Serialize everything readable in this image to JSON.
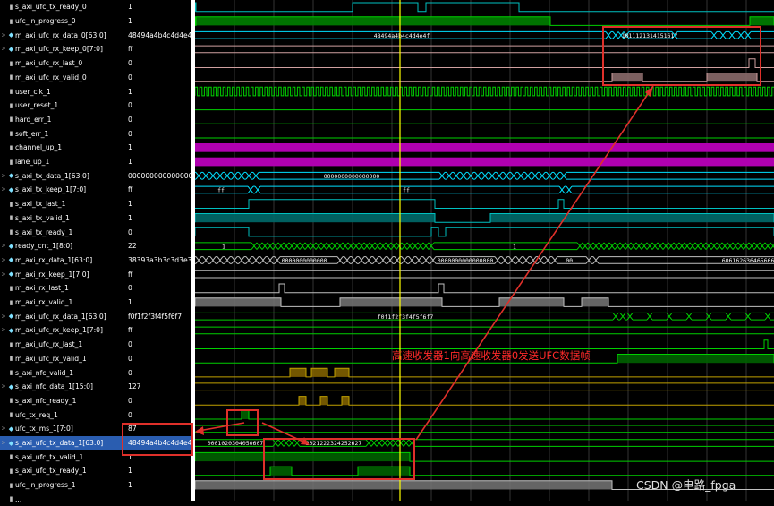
{
  "signals": [
    {
      "name": "s_axi_ufc_tx_ready_0",
      "value": "1",
      "group": false,
      "kind": "bit"
    },
    {
      "name": "ufc_in_progress_0",
      "value": "1",
      "group": false,
      "kind": "bit"
    },
    {
      "name": "m_axi_ufc_rx_data_0[63:0]",
      "value": "48494a4b4c4d4e4f",
      "group": true,
      "kind": "bus"
    },
    {
      "name": "m_axi_ufc_rx_keep_0[7:0]",
      "value": "ff",
      "group": true,
      "kind": "bus"
    },
    {
      "name": "m_axi_ufc_rx_last_0",
      "value": "0",
      "group": false,
      "kind": "bit"
    },
    {
      "name": "m_axi_ufc_rx_valid_0",
      "value": "0",
      "group": false,
      "kind": "bit"
    },
    {
      "name": "user_clk_1",
      "value": "1",
      "group": false,
      "kind": "bit"
    },
    {
      "name": "user_reset_1",
      "value": "0",
      "group": false,
      "kind": "bit"
    },
    {
      "name": "hard_err_1",
      "value": "0",
      "group": false,
      "kind": "bit"
    },
    {
      "name": "soft_err_1",
      "value": "0",
      "group": false,
      "kind": "bit"
    },
    {
      "name": "channel_up_1",
      "value": "1",
      "group": false,
      "kind": "bit"
    },
    {
      "name": "lane_up_1",
      "value": "1",
      "group": false,
      "kind": "bit"
    },
    {
      "name": "s_axi_tx_data_1[63:0]",
      "value": "0000000000000000",
      "group": true,
      "kind": "bus"
    },
    {
      "name": "s_axi_tx_keep_1[7:0]",
      "value": "ff",
      "group": true,
      "kind": "bus"
    },
    {
      "name": "s_axi_tx_last_1",
      "value": "1",
      "group": false,
      "kind": "bit"
    },
    {
      "name": "s_axi_tx_valid_1",
      "value": "1",
      "group": false,
      "kind": "bit"
    },
    {
      "name": "s_axi_tx_ready_1",
      "value": "0",
      "group": false,
      "kind": "bit"
    },
    {
      "name": "ready_cnt_1[8:0]",
      "value": "22",
      "group": true,
      "kind": "bus"
    },
    {
      "name": "m_axi_rx_data_1[63:0]",
      "value": "38393a3b3c3d3e3f",
      "group": true,
      "kind": "bus"
    },
    {
      "name": "m_axi_rx_keep_1[7:0]",
      "value": "ff",
      "group": true,
      "kind": "bus"
    },
    {
      "name": "m_axi_rx_last_1",
      "value": "0",
      "group": false,
      "kind": "bit"
    },
    {
      "name": "m_axi_rx_valid_1",
      "value": "1",
      "group": false,
      "kind": "bit"
    },
    {
      "name": "m_axi_ufc_rx_data_1[63:0]",
      "value": "f0f1f2f3f4f5f6f7",
      "group": true,
      "kind": "bus"
    },
    {
      "name": "m_axi_ufc_rx_keep_1[7:0]",
      "value": "ff",
      "group": true,
      "kind": "bus"
    },
    {
      "name": "m_axi_ufc_rx_last_1",
      "value": "0",
      "group": false,
      "kind": "bit"
    },
    {
      "name": "m_axi_ufc_rx_valid_1",
      "value": "0",
      "group": false,
      "kind": "bit"
    },
    {
      "name": "s_axi_nfc_valid_1",
      "value": "0",
      "group": false,
      "kind": "bit"
    },
    {
      "name": "s_axi_nfc_data_1[15:0]",
      "value": "127",
      "group": true,
      "kind": "bus"
    },
    {
      "name": "s_axi_nfc_ready_1",
      "value": "0",
      "group": false,
      "kind": "bit"
    },
    {
      "name": "ufc_tx_req_1",
      "value": "0",
      "group": false,
      "kind": "bit"
    },
    {
      "name": "ufc_tx_ms_1[7:0]",
      "value": "87",
      "group": true,
      "kind": "bus"
    },
    {
      "name": "s_axi_ufc_tx_data_1[63:0]",
      "value": "48494a4b4c4d4e4f",
      "group": true,
      "kind": "bus",
      "selected": true
    },
    {
      "name": "s_axi_ufc_tx_valid_1",
      "value": "1",
      "group": false,
      "kind": "bit"
    },
    {
      "name": "s_axi_ufc_tx_ready_1",
      "value": "1",
      "group": false,
      "kind": "bit"
    },
    {
      "name": "ufc_in_progress_1",
      "value": "1",
      "group": false,
      "kind": "bit"
    },
    {
      "name": "...",
      "value": "",
      "group": false,
      "kind": "bit"
    }
  ],
  "bus_labels": {
    "m_axi_ufc_rx_data_0": [
      "48494a4b4c4d4e4f",
      "1011121314151617"
    ],
    "s_axi_tx_data_1": [
      "0000000000000000"
    ],
    "s_axi_tx_keep_1": [
      "ff",
      "ff"
    ],
    "ready_cnt_1": [
      "1",
      "1"
    ],
    "m_axi_rx_data_1": [
      "0000000000000...",
      "0000000000000000",
      "00...",
      "6061626364656667"
    ],
    "m_axi_ufc_rx_data_1": [
      "f0f1f2f3f4f5f6f7"
    ],
    "s_axi_ufc_tx_data_1": [
      "0001020304050607",
      "2021222324252627"
    ]
  },
  "annotation": "高速收发器1向高速收发器0发送UFC数据帧",
  "watermark": "CSDN @电路_fpga",
  "colors": {
    "bus": "#00e0ff",
    "bit": "#00d000",
    "red": "#e0302a",
    "cursor": "#ffff00",
    "magenta": "#b000b0",
    "ufc_rx0": "#d0a0a0",
    "tx_valid": "#00c0c0",
    "nfc": "#c0a000",
    "grey": "#c0c0c0"
  }
}
